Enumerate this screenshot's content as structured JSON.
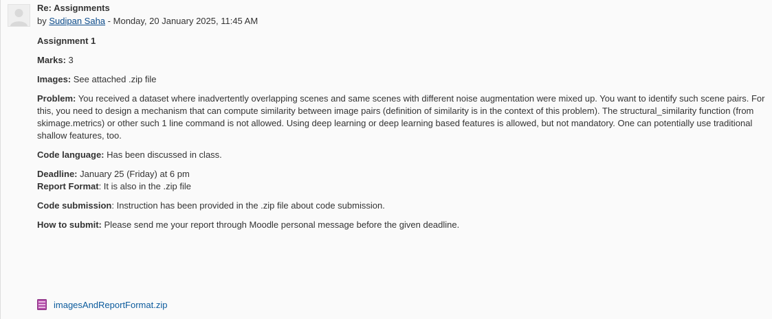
{
  "post": {
    "subject": "Re: Assignments",
    "by": "by",
    "author": "Sudipan Saha",
    "date_sep": "-",
    "date": "Monday, 20 January 2025, 11:45 AM"
  },
  "body": {
    "title": "Assignment 1",
    "marks_label": "Marks:",
    "marks_value": "3",
    "images_label": "Images:",
    "images_value": "See attached .zip file",
    "problem_label": "Problem:",
    "problem_value": "You received a dataset where inadvertently overlapping scenes and same scenes with different noise augmentation were mixed up. You want to identify such scene pairs. For this, you need to design a mechanism that can compute similarity between image pairs (definition of similarity is in the context of this problem). The structural_similarity function (from skimage.metrics) or other such 1 line command is not allowed. Using deep learning or deep learning based features is allowed, but not mandatory. One can potentially use traditional shallow features, too.",
    "code_language_label": "Code language:",
    "code_language_value": "Has been discussed in class.",
    "deadline_label": "Deadline:",
    "deadline_value": "January 25 (Friday) at 6 pm",
    "report_format_label": "Report Format",
    "report_format_value": ": It is also in the .zip file",
    "code_submission_label": "Code submission",
    "code_submission_value": ": Instruction has been provided in the .zip file about code submission.",
    "how_to_submit_label": "How to submit:",
    "how_to_submit_value": "Please send me your report through Moodle personal message before the given deadline."
  },
  "attachment": {
    "icon": "archive-file-icon",
    "filename": "imagesAndReportFormat.zip"
  },
  "colors": {
    "link": "#0a5a9c",
    "archive_icon": "#b04aa6"
  }
}
